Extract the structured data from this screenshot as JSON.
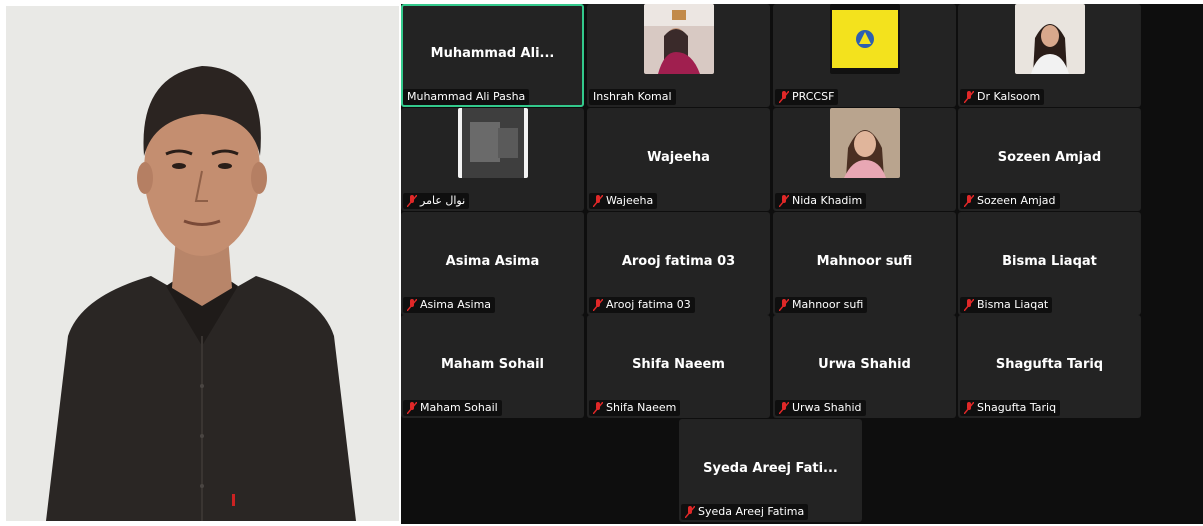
{
  "participants": [
    {
      "name": "Muhammad  Ali...",
      "label": "Muhammad Ali Pasha",
      "muted": false,
      "video": false,
      "active": true
    },
    {
      "name": "",
      "label": "Inshrah Komal",
      "muted": false,
      "video": true
    },
    {
      "name": "",
      "label": "PRCCSF",
      "muted": true,
      "video": true
    },
    {
      "name": "",
      "label": "Dr Kalsoom",
      "muted": true,
      "video": true
    },
    {
      "name": "",
      "label": "نوال عامر",
      "muted": true,
      "video": true
    },
    {
      "name": "Wajeeha",
      "label": "Wajeeha",
      "muted": true,
      "video": false
    },
    {
      "name": "",
      "label": "Nida Khadim",
      "muted": true,
      "video": true
    },
    {
      "name": "Sozeen Amjad",
      "label": "Sozeen Amjad",
      "muted": true,
      "video": false
    },
    {
      "name": "Asima Asima",
      "label": "Asima Asima",
      "muted": true,
      "video": false
    },
    {
      "name": "Arooj fatima 03",
      "label": "Arooj fatima 03",
      "muted": true,
      "video": false
    },
    {
      "name": "Mahnoor sufi",
      "label": "Mahnoor sufi",
      "muted": true,
      "video": false
    },
    {
      "name": "Bisma Liaqat",
      "label": "Bisma Liaqat",
      "muted": true,
      "video": false
    },
    {
      "name": "Maham Sohail",
      "label": "Maham Sohail",
      "muted": true,
      "video": false
    },
    {
      "name": "Shifa Naeem",
      "label": "Shifa Naeem",
      "muted": true,
      "video": false
    },
    {
      "name": "Urwa Shahid",
      "label": "Urwa Shahid",
      "muted": true,
      "video": false
    },
    {
      "name": "Shagufta Tariq",
      "label": "Shagufta Tariq",
      "muted": true,
      "video": false
    },
    {
      "name": "Syeda Areej Fati...",
      "label": "Syeda Areej Fatima",
      "muted": true,
      "video": false
    }
  ],
  "colors": {
    "tile_bg": "#232323",
    "gallery_bg": "#0e0e0e",
    "active_border": "#33c98c",
    "muted_icon": "#e02828"
  }
}
